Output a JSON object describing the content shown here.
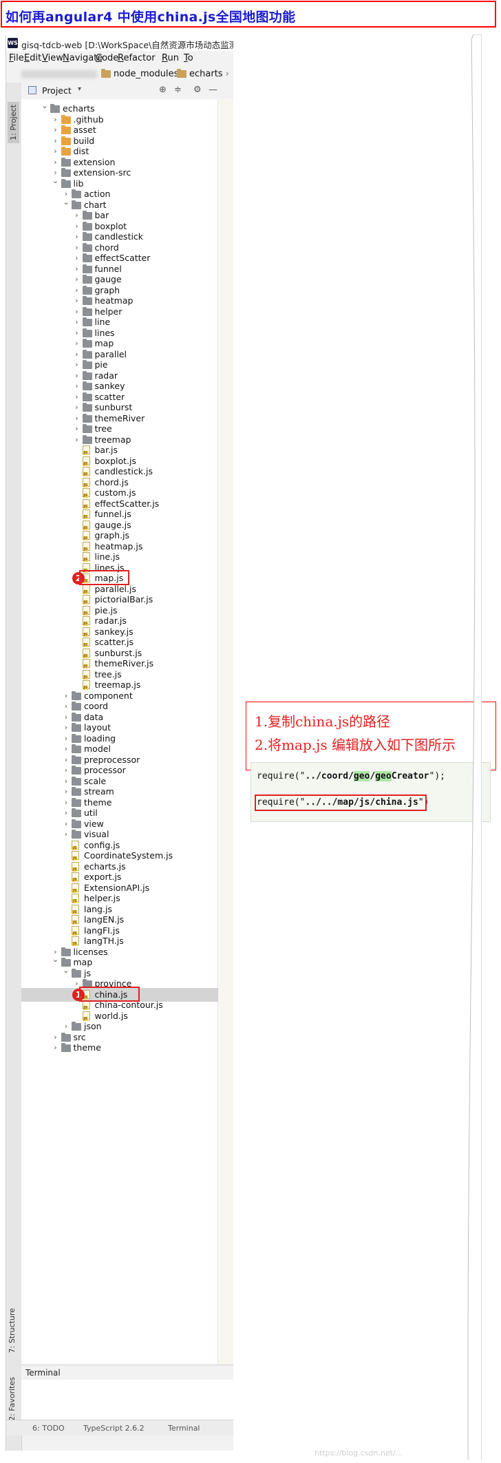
{
  "banner": {
    "title": "如何再angular4 中使用china.js全国地图功能"
  },
  "ide": {
    "window_title": "gisq-tdcb-web [D:\\WorkSpace\\自然资源市场动态监测平",
    "menu": [
      {
        "key": "F",
        "rest": "ile"
      },
      {
        "key": "E",
        "rest": "dit"
      },
      {
        "key": "V",
        "rest": "iew"
      },
      {
        "key": "N",
        "rest": "avigate"
      },
      {
        "key": "C",
        "rest": "ode"
      },
      {
        "key": "R",
        "rest": "efactor"
      },
      {
        "key": "R",
        "rest": "un"
      },
      {
        "key": "T",
        "rest": "o"
      }
    ],
    "breadcrumb": {
      "hidden_project": "gisq-tdcb-web",
      "items": [
        "node_modules",
        "echarts"
      ]
    },
    "project_panel": {
      "label": "Project",
      "dropdown": "▾"
    },
    "left_tabs": {
      "project": "1: Project",
      "structure": "7: Structure",
      "favorites": "2: Favorites"
    },
    "tree": [
      {
        "label": "echarts",
        "type": "folder",
        "depth": 0,
        "state": "open"
      },
      {
        "label": ".github",
        "type": "folder-orange",
        "depth": 1,
        "state": "closed"
      },
      {
        "label": "asset",
        "type": "folder-orange",
        "depth": 1,
        "state": "closed"
      },
      {
        "label": "build",
        "type": "folder-orange",
        "depth": 1,
        "state": "closed"
      },
      {
        "label": "dist",
        "type": "folder-orange",
        "depth": 1,
        "state": "closed"
      },
      {
        "label": "extension",
        "type": "folder",
        "depth": 1,
        "state": "closed"
      },
      {
        "label": "extension-src",
        "type": "folder",
        "depth": 1,
        "state": "closed"
      },
      {
        "label": "lib",
        "type": "folder",
        "depth": 1,
        "state": "open"
      },
      {
        "label": "action",
        "type": "folder",
        "depth": 2,
        "state": "closed"
      },
      {
        "label": "chart",
        "type": "folder",
        "depth": 2,
        "state": "open"
      },
      {
        "label": "bar",
        "type": "folder",
        "depth": 3,
        "state": "closed"
      },
      {
        "label": "boxplot",
        "type": "folder",
        "depth": 3,
        "state": "closed"
      },
      {
        "label": "candlestick",
        "type": "folder",
        "depth": 3,
        "state": "closed"
      },
      {
        "label": "chord",
        "type": "folder",
        "depth": 3,
        "state": "closed"
      },
      {
        "label": "effectScatter",
        "type": "folder",
        "depth": 3,
        "state": "closed"
      },
      {
        "label": "funnel",
        "type": "folder",
        "depth": 3,
        "state": "closed"
      },
      {
        "label": "gauge",
        "type": "folder",
        "depth": 3,
        "state": "closed"
      },
      {
        "label": "graph",
        "type": "folder",
        "depth": 3,
        "state": "closed"
      },
      {
        "label": "heatmap",
        "type": "folder",
        "depth": 3,
        "state": "closed"
      },
      {
        "label": "helper",
        "type": "folder",
        "depth": 3,
        "state": "closed"
      },
      {
        "label": "line",
        "type": "folder",
        "depth": 3,
        "state": "closed"
      },
      {
        "label": "lines",
        "type": "folder",
        "depth": 3,
        "state": "closed"
      },
      {
        "label": "map",
        "type": "folder",
        "depth": 3,
        "state": "closed"
      },
      {
        "label": "parallel",
        "type": "folder",
        "depth": 3,
        "state": "closed"
      },
      {
        "label": "pie",
        "type": "folder",
        "depth": 3,
        "state": "closed"
      },
      {
        "label": "radar",
        "type": "folder",
        "depth": 3,
        "state": "closed"
      },
      {
        "label": "sankey",
        "type": "folder",
        "depth": 3,
        "state": "closed"
      },
      {
        "label": "scatter",
        "type": "folder",
        "depth": 3,
        "state": "closed"
      },
      {
        "label": "sunburst",
        "type": "folder",
        "depth": 3,
        "state": "closed"
      },
      {
        "label": "themeRiver",
        "type": "folder",
        "depth": 3,
        "state": "closed"
      },
      {
        "label": "tree",
        "type": "folder",
        "depth": 3,
        "state": "closed"
      },
      {
        "label": "treemap",
        "type": "folder",
        "depth": 3,
        "state": "closed"
      },
      {
        "label": "bar.js",
        "type": "js",
        "depth": 3
      },
      {
        "label": "boxplot.js",
        "type": "js",
        "depth": 3
      },
      {
        "label": "candlestick.js",
        "type": "js",
        "depth": 3
      },
      {
        "label": "chord.js",
        "type": "js",
        "depth": 3
      },
      {
        "label": "custom.js",
        "type": "js",
        "depth": 3
      },
      {
        "label": "effectScatter.js",
        "type": "js",
        "depth": 3
      },
      {
        "label": "funnel.js",
        "type": "js",
        "depth": 3
      },
      {
        "label": "gauge.js",
        "type": "js",
        "depth": 3
      },
      {
        "label": "graph.js",
        "type": "js",
        "depth": 3
      },
      {
        "label": "heatmap.js",
        "type": "js",
        "depth": 3
      },
      {
        "label": "line.js",
        "type": "js",
        "depth": 3
      },
      {
        "label": "lines.js",
        "type": "js",
        "depth": 3
      },
      {
        "label": "map.js",
        "type": "js",
        "depth": 3,
        "marker": "2"
      },
      {
        "label": "parallel.js",
        "type": "js",
        "depth": 3
      },
      {
        "label": "pictorialBar.js",
        "type": "js",
        "depth": 3
      },
      {
        "label": "pie.js",
        "type": "js",
        "depth": 3
      },
      {
        "label": "radar.js",
        "type": "js",
        "depth": 3
      },
      {
        "label": "sankey.js",
        "type": "js",
        "depth": 3
      },
      {
        "label": "scatter.js",
        "type": "js",
        "depth": 3
      },
      {
        "label": "sunburst.js",
        "type": "js",
        "depth": 3
      },
      {
        "label": "themeRiver.js",
        "type": "js",
        "depth": 3
      },
      {
        "label": "tree.js",
        "type": "js",
        "depth": 3
      },
      {
        "label": "treemap.js",
        "type": "js",
        "depth": 3
      },
      {
        "label": "component",
        "type": "folder",
        "depth": 2,
        "state": "closed"
      },
      {
        "label": "coord",
        "type": "folder",
        "depth": 2,
        "state": "closed"
      },
      {
        "label": "data",
        "type": "folder",
        "depth": 2,
        "state": "closed"
      },
      {
        "label": "layout",
        "type": "folder",
        "depth": 2,
        "state": "closed"
      },
      {
        "label": "loading",
        "type": "folder",
        "depth": 2,
        "state": "closed"
      },
      {
        "label": "model",
        "type": "folder",
        "depth": 2,
        "state": "closed"
      },
      {
        "label": "preprocessor",
        "type": "folder",
        "depth": 2,
        "state": "closed"
      },
      {
        "label": "processor",
        "type": "folder",
        "depth": 2,
        "state": "closed"
      },
      {
        "label": "scale",
        "type": "folder",
        "depth": 2,
        "state": "closed"
      },
      {
        "label": "stream",
        "type": "folder",
        "depth": 2,
        "state": "closed"
      },
      {
        "label": "theme",
        "type": "folder",
        "depth": 2,
        "state": "closed"
      },
      {
        "label": "util",
        "type": "folder",
        "depth": 2,
        "state": "closed"
      },
      {
        "label": "view",
        "type": "folder",
        "depth": 2,
        "state": "closed"
      },
      {
        "label": "visual",
        "type": "folder",
        "depth": 2,
        "state": "closed"
      },
      {
        "label": "config.js",
        "type": "js",
        "depth": 2
      },
      {
        "label": "CoordinateSystem.js",
        "type": "js",
        "depth": 2
      },
      {
        "label": "echarts.js",
        "type": "js",
        "depth": 2
      },
      {
        "label": "export.js",
        "type": "js",
        "depth": 2
      },
      {
        "label": "ExtensionAPI.js",
        "type": "js",
        "depth": 2
      },
      {
        "label": "helper.js",
        "type": "js",
        "depth": 2
      },
      {
        "label": "lang.js",
        "type": "js",
        "depth": 2
      },
      {
        "label": "langEN.js",
        "type": "js",
        "depth": 2
      },
      {
        "label": "langFI.js",
        "type": "js",
        "depth": 2
      },
      {
        "label": "langTH.js",
        "type": "js",
        "depth": 2
      },
      {
        "label": "licenses",
        "type": "folder",
        "depth": 1,
        "state": "closed"
      },
      {
        "label": "map",
        "type": "folder",
        "depth": 1,
        "state": "open"
      },
      {
        "label": "js",
        "type": "folder",
        "depth": 2,
        "state": "open"
      },
      {
        "label": "province",
        "type": "folder",
        "depth": 3,
        "state": "closed"
      },
      {
        "label": "china.js",
        "type": "js",
        "depth": 3,
        "selected": true,
        "marker": "1"
      },
      {
        "label": "china-contour.js",
        "type": "js",
        "depth": 3
      },
      {
        "label": "world.js",
        "type": "js",
        "depth": 3
      },
      {
        "label": "json",
        "type": "folder",
        "depth": 2,
        "state": "closed"
      },
      {
        "label": "src",
        "type": "folder",
        "depth": 1,
        "state": "closed"
      },
      {
        "label": "theme",
        "type": "folder",
        "depth": 1,
        "state": "closed"
      }
    ],
    "terminal_label": "Terminal",
    "status": {
      "todo": "6: TODO",
      "typescript": "TypeScript 2.6.2",
      "terminal": "Terminal"
    }
  },
  "annotation": {
    "step1": "1.复制china.js的路径",
    "step2": "2.将map.js 编辑放入如下图所示"
  },
  "code": {
    "line1": {
      "pre": "require(\"",
      "path_a": "../coord/",
      "hl1": "geo",
      "mid": "/",
      "hl2": "geo",
      "path_b": "Creator",
      "post": "\");"
    },
    "line2": {
      "pre": "require(\"",
      "path": "../../map/js/china.js",
      "post": "\")"
    }
  },
  "watermark": "https://blog.csdn.net/..."
}
